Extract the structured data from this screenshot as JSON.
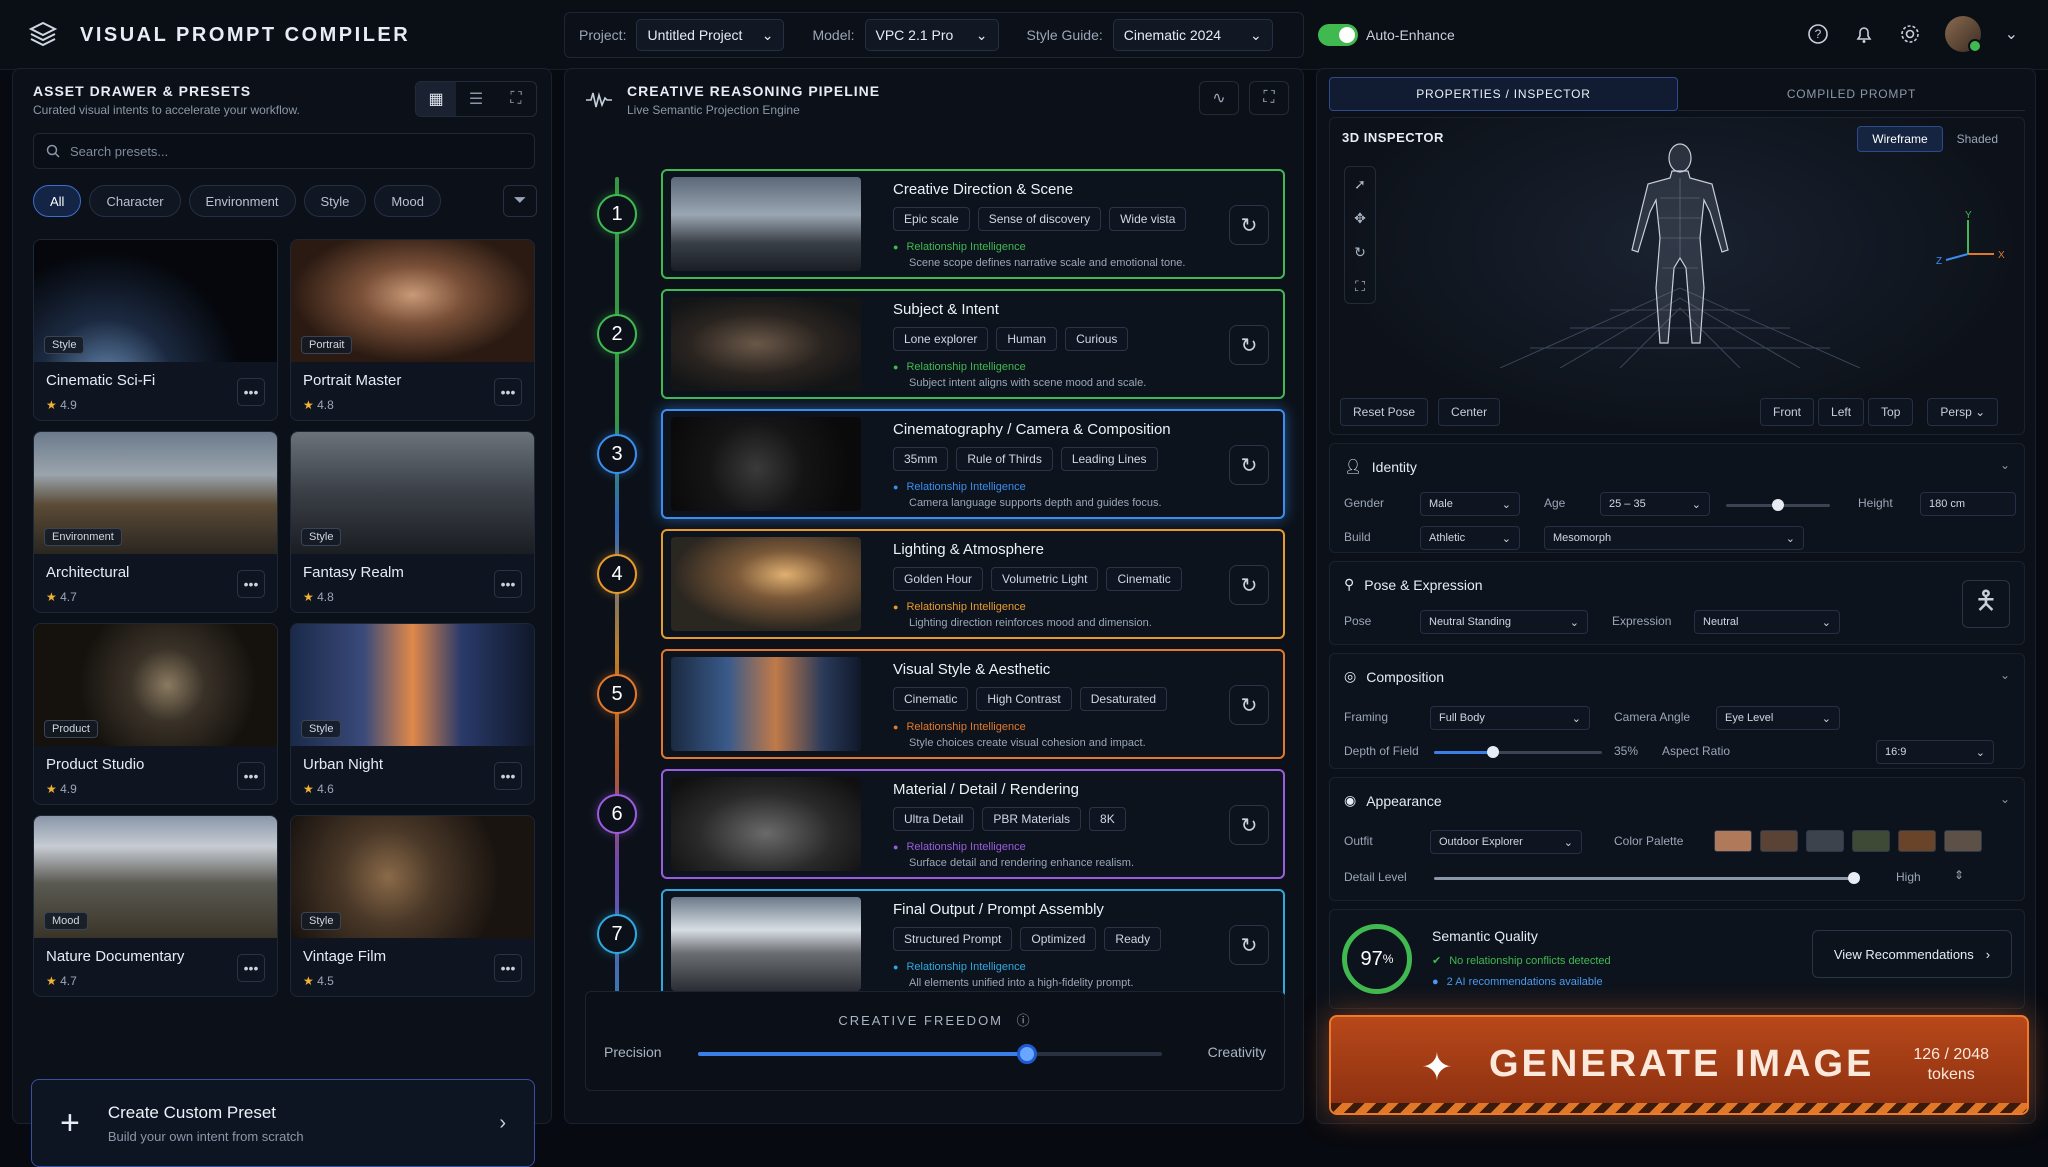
{
  "app": {
    "title": "VISUAL PROMPT COMPILER"
  },
  "toolbar": {
    "project_label": "Project:",
    "project_value": "Untitled Project",
    "model_label": "Model:",
    "model_value": "VPC 2.1 Pro",
    "style_label": "Style Guide:",
    "style_value": "Cinematic 2024",
    "auto_enhance": "Auto-Enhance"
  },
  "drawer": {
    "title": "ASSET DRAWER & PRESETS",
    "subtitle": "Curated visual intents to accelerate your workflow.",
    "search_placeholder": "Search presets...",
    "chips": [
      "All",
      "Character",
      "Environment",
      "Style",
      "Mood"
    ],
    "cards": [
      {
        "name": "Cinematic Sci-Fi",
        "badge": "Style",
        "rating": "4.9"
      },
      {
        "name": "Portrait Master",
        "badge": "Portrait",
        "rating": "4.8"
      },
      {
        "name": "Architectural",
        "badge": "Environment",
        "rating": "4.7"
      },
      {
        "name": "Fantasy Realm",
        "badge": "Style",
        "rating": "4.8"
      },
      {
        "name": "Product Studio",
        "badge": "Product",
        "rating": "4.9"
      },
      {
        "name": "Urban Night",
        "badge": "Style",
        "rating": "4.6"
      },
      {
        "name": "Nature Documentary",
        "badge": "Mood",
        "rating": "4.7"
      },
      {
        "name": "Vintage Film",
        "badge": "Style",
        "rating": "4.5"
      }
    ],
    "create_title": "Create Custom Preset",
    "create_sub": "Build your own intent from scratch"
  },
  "pipeline": {
    "title": "CREATIVE REASONING PIPELINE",
    "subtitle": "Live Semantic Projection Engine",
    "ri_label": "Relationship Intelligence",
    "steps": [
      {
        "num": "1",
        "title": "Creative Direction & Scene",
        "tags": [
          "Epic scale",
          "Sense of discovery",
          "Wide vista"
        ],
        "desc": "Scene scope defines narrative scale and emotional tone.",
        "color": "#3fb950"
      },
      {
        "num": "2",
        "title": "Subject & Intent",
        "tags": [
          "Lone explorer",
          "Human",
          "Curious"
        ],
        "desc": "Subject intent aligns with scene mood and scale.",
        "color": "#3fb950"
      },
      {
        "num": "3",
        "title": "Cinematography / Camera & Composition",
        "tags": [
          "35mm",
          "Rule of Thirds",
          "Leading Lines"
        ],
        "desc": "Camera language supports depth and guides focus.",
        "color": "#3a8ef0"
      },
      {
        "num": "4",
        "title": "Lighting & Atmosphere",
        "tags": [
          "Golden Hour",
          "Volumetric Light",
          "Cinematic"
        ],
        "desc": "Lighting direction reinforces mood and dimension.",
        "color": "#e89a2a"
      },
      {
        "num": "5",
        "title": "Visual Style & Aesthetic",
        "tags": [
          "Cinematic",
          "High Contrast",
          "Desaturated"
        ],
        "desc": "Style choices create visual cohesion and impact.",
        "color": "#e4782a"
      },
      {
        "num": "6",
        "title": "Material / Detail / Rendering",
        "tags": [
          "Ultra Detail",
          "PBR Materials",
          "8K"
        ],
        "desc": "Surface detail and rendering enhance realism.",
        "color": "#9a5ce0"
      },
      {
        "num": "7",
        "title": "Final Output / Prompt Assembly",
        "tags": [
          "Structured Prompt",
          "Optimized",
          "Ready"
        ],
        "desc": "All elements unified into a high-fidelity prompt.",
        "color": "#2fa8e0"
      }
    ],
    "freedom_label": "CREATIVE FREEDOM",
    "precision": "Precision",
    "creativity": "Creativity",
    "freedom_value": 0.71
  },
  "inspector": {
    "tab_properties": "PROPERTIES / INSPECTOR",
    "tab_compiled": "COMPILED PROMPT",
    "title": "3D INSPECTOR",
    "wireframe": "Wireframe",
    "shaded": "Shaded",
    "reset_pose": "Reset Pose",
    "center": "Center",
    "views": [
      "Front",
      "Left",
      "Top"
    ],
    "persp": "Persp",
    "axis_x": "X",
    "axis_y": "Y",
    "axis_z": "Z"
  },
  "identity": {
    "title": "Identity",
    "gender_label": "Gender",
    "gender": "Male",
    "age_label": "Age",
    "age": "25 – 35",
    "height_label": "Height",
    "height": "180 cm",
    "build_label": "Build",
    "build": "Athletic",
    "somatotype": "Mesomorph",
    "age_slider": 0.5
  },
  "pose": {
    "title": "Pose & Expression",
    "pose_label": "Pose",
    "pose": "Neutral Standing",
    "expr_label": "Expression",
    "expr": "Neutral"
  },
  "composition": {
    "title": "Composition",
    "framing_label": "Framing",
    "framing": "Full Body",
    "angle_label": "Camera Angle",
    "angle": "Eye Level",
    "dof_label": "Depth of Field",
    "dof": "35%",
    "dof_value": 0.35,
    "aspect_label": "Aspect Ratio",
    "aspect": "16:9"
  },
  "appearance": {
    "title": "Appearance",
    "outfit_label": "Outfit",
    "outfit": "Outdoor Explorer",
    "palette_label": "Color Palette",
    "palette": [
      "#b07a5a",
      "#5a4334",
      "#3c434c",
      "#3e4a36",
      "#6a4428",
      "#5c5047"
    ],
    "detail_label": "Detail Level",
    "detail": "High",
    "detail_value": 1.0
  },
  "quality": {
    "title": "Semantic Quality",
    "score": "97",
    "pct": "%",
    "line1": "No relationship conflicts detected",
    "line2": "2 AI recommendations available",
    "btn": "View Recommendations"
  },
  "generate": {
    "label": "GENERATE IMAGE",
    "tokens": "126 / 2048",
    "tokens_unit": "tokens"
  }
}
